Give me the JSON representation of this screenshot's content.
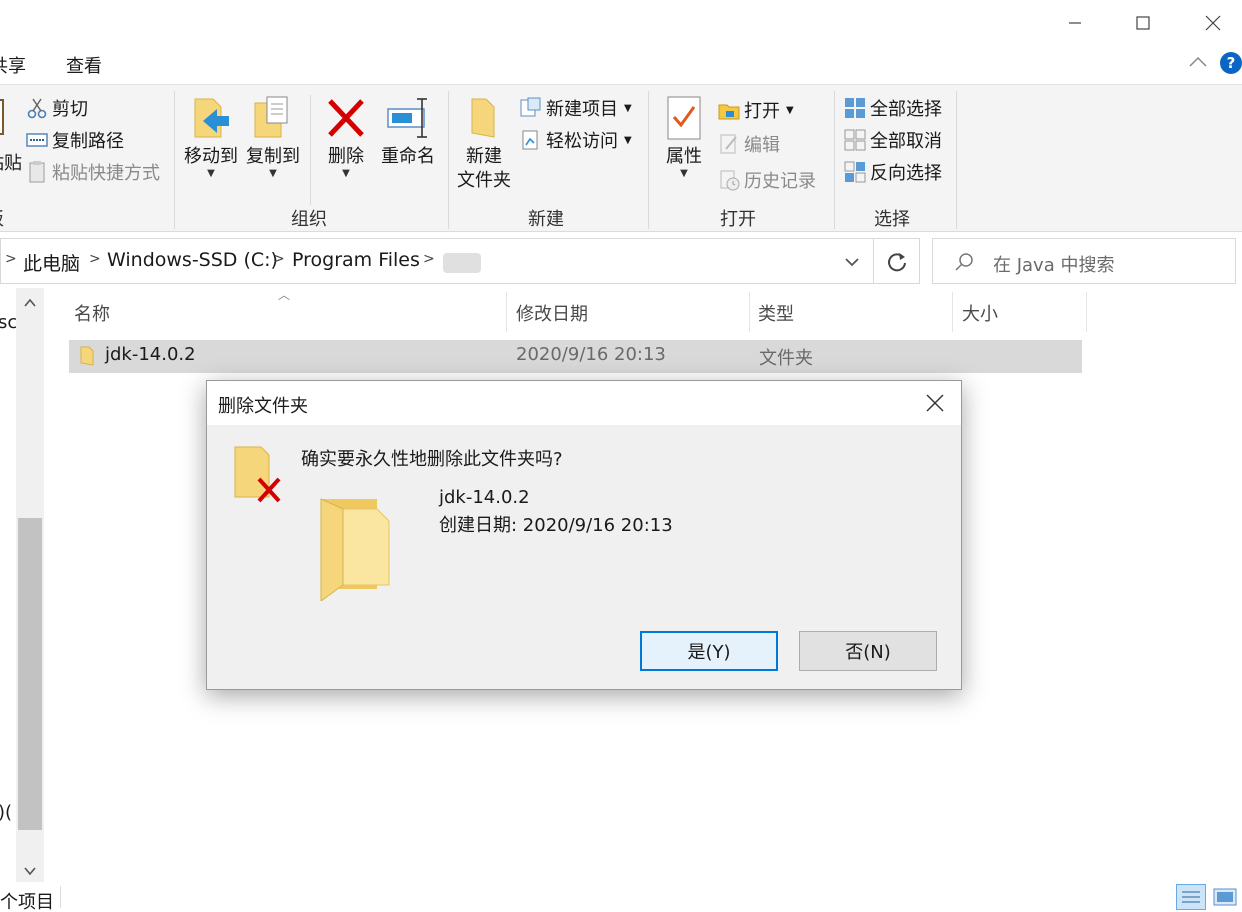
{
  "menu": {
    "share_partial": "共享",
    "view": "查看"
  },
  "ribbon": {
    "clipboard": {
      "paste_partial": "粘贴",
      "cut": "剪切",
      "copy_path": "复制路径",
      "paste_shortcut": "粘贴快捷方式",
      "group_label_partial": "剪贴板"
    },
    "organize": {
      "move_to": "移动到",
      "copy_to": "复制到",
      "delete": "删除",
      "rename": "重命名",
      "group_label": "组织"
    },
    "new": {
      "new_folder_line1": "新建",
      "new_folder_line2": "文件夹",
      "new_item": "新建项目",
      "easy_access": "轻松访问",
      "group_label": "新建"
    },
    "open": {
      "properties": "属性",
      "open": "打开",
      "edit": "编辑",
      "history": "历史记录",
      "group_label": "打开"
    },
    "select": {
      "select_all": "全部选择",
      "select_none": "全部取消",
      "invert_selection": "反向选择",
      "group_label": "选择"
    }
  },
  "address": {
    "crumbs": [
      "此电脑",
      "Windows-SSD (C:)",
      "Program Files"
    ],
    "search_placeholder": "在 Java 中搜索"
  },
  "nav": {
    "partial_top": "sc",
    "partial_bottom": ")("
  },
  "columns": {
    "name": "名称",
    "date": "修改日期",
    "type": "类型",
    "size": "大小"
  },
  "files": [
    {
      "name": "jdk-14.0.2",
      "date": "2020/9/16 20:13",
      "type": "文件夹",
      "size": ""
    }
  ],
  "status": {
    "items_partial": "个项目"
  },
  "dialog": {
    "title": "删除文件夹",
    "question": "确实要永久性地删除此文件夹吗?",
    "item_name": "jdk-14.0.2",
    "created": "创建日期: 2020/9/16 20:13",
    "yes_label": "是(Y)",
    "no_label": "否(N)"
  },
  "colors": {
    "selected_row": "#d9d9d9",
    "accent": "#0078d7",
    "delete_red": "#d40000",
    "folder_yellow": "#f5d67a"
  }
}
